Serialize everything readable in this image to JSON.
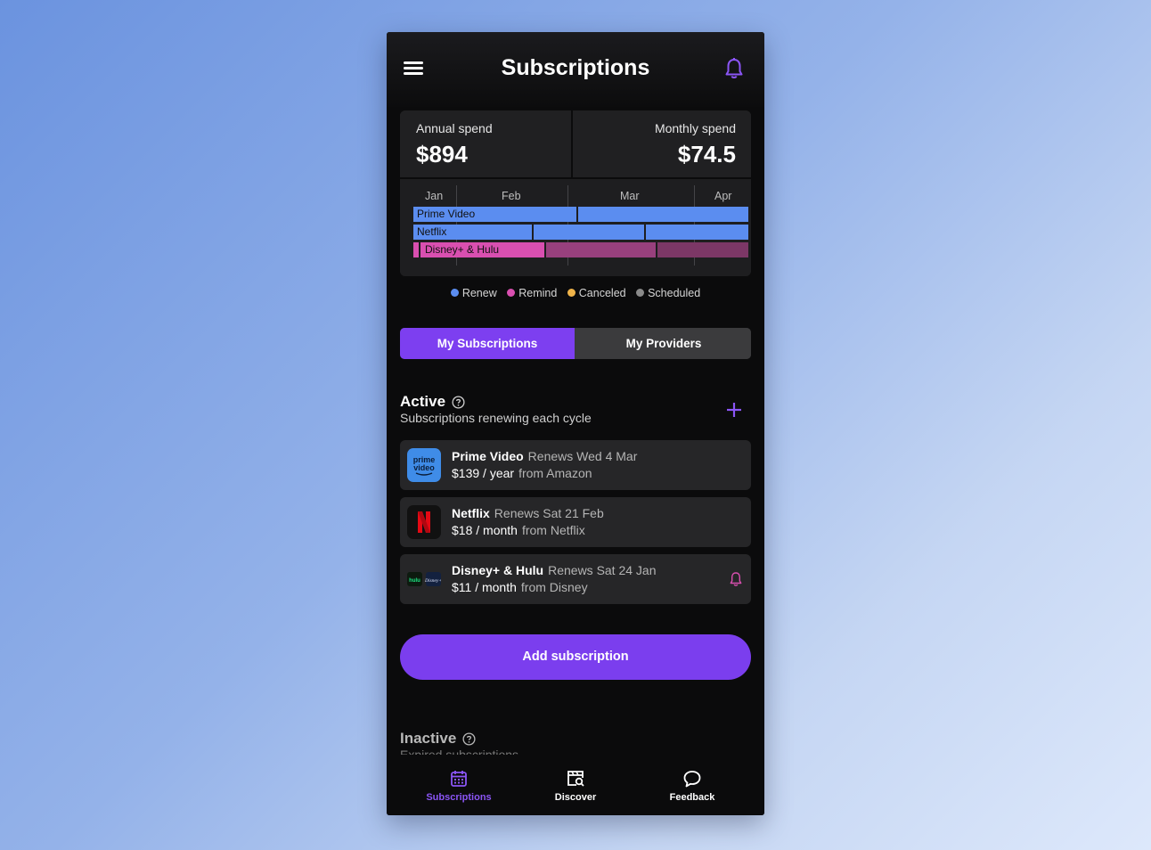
{
  "header": {
    "title": "Subscriptions"
  },
  "spend": {
    "annual_label": "Annual spend",
    "annual_value": "$894",
    "monthly_label": "Monthly spend",
    "monthly_value": "$74.5"
  },
  "timeline": {
    "months": [
      "Jan",
      "Feb",
      "Mar",
      "Apr"
    ],
    "rows": [
      {
        "label": "Prime Video",
        "status": "renew"
      },
      {
        "label": "Netflix",
        "status": "renew"
      },
      {
        "label": "Disney+ & Hulu",
        "status": "remind"
      }
    ]
  },
  "legend": [
    {
      "label": "Renew",
      "color": "#5b8df0"
    },
    {
      "label": "Remind",
      "color": "#d94fb0"
    },
    {
      "label": "Canceled",
      "color": "#f0b44a"
    },
    {
      "label": "Scheduled",
      "color": "#8a8a8a"
    }
  ],
  "segments": {
    "active_label": "My Subscriptions",
    "inactive_label": "My Providers"
  },
  "active": {
    "title": "Active",
    "subtitle": "Subscriptions renewing each cycle",
    "items": [
      {
        "name": "Prime Video",
        "renew": "Renews Wed 4 Mar",
        "price": "$139 / year",
        "from": "from Amazon",
        "logo_text": "prime video"
      },
      {
        "name": "Netflix",
        "renew": "Renews Sat 21 Feb",
        "price": "$18 / month",
        "from": "from Netflix",
        "logo_text": "N"
      },
      {
        "name": "Disney+ & Hulu",
        "renew": "Renews Sat 24 Jan",
        "price": "$11 / month",
        "from": "from Disney",
        "logo_text_a": "hulu",
        "logo_text_b": "Disney+"
      }
    ]
  },
  "add_button": "Add subscription",
  "inactive": {
    "title": "Inactive",
    "subtitle": "Expired subscriptions"
  },
  "tabs": [
    {
      "label": "Subscriptions",
      "active": true
    },
    {
      "label": "Discover",
      "active": false
    },
    {
      "label": "Feedback",
      "active": false
    }
  ],
  "colors": {
    "accent": "#7b3eee",
    "renew": "#5b8df0",
    "remind": "#d94fb0"
  }
}
